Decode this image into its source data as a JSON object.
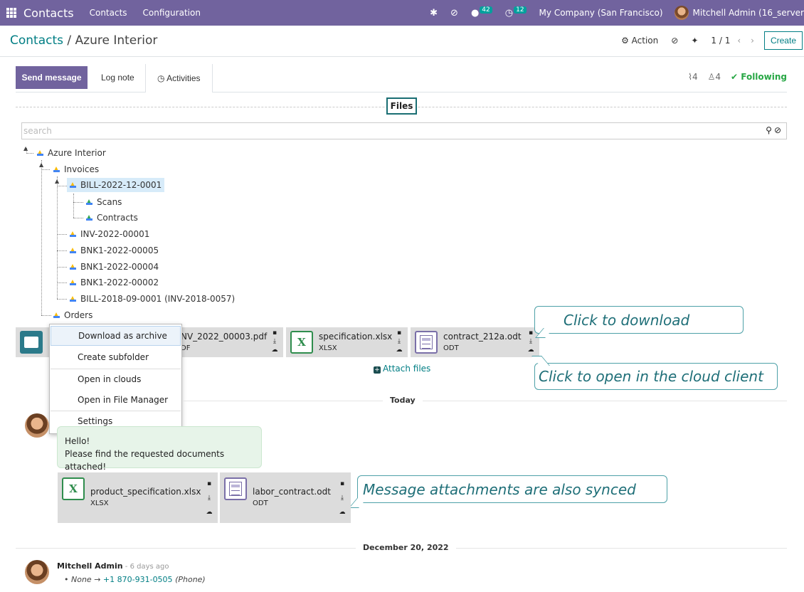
{
  "navbar": {
    "app_name": "Contacts",
    "menus": [
      "Contacts",
      "Configuration"
    ],
    "messages_count": "42",
    "activities_count": "12",
    "company": "My Company (San Francisco)",
    "user": "Mitchell Admin (16_server"
  },
  "control_panel": {
    "breadcrumb_root": "Contacts",
    "breadcrumb_sep": " / ",
    "breadcrumb_current": "Azure Interior",
    "action_label": "Action",
    "pager": "1 / 1",
    "create_label": "Create"
  },
  "chatter": {
    "send_message": "Send message",
    "log_note": "Log note",
    "activities": "Activities",
    "attachments_count": "4",
    "followers_count": "4",
    "following": "Following",
    "files_tab": "Files",
    "search_placeholder": "search",
    "attach_files": "Attach files"
  },
  "tree": {
    "root": "Azure Interior",
    "invoices": "Invoices",
    "bill_2022": "BILL-2022-12-0001",
    "scans": "Scans",
    "contracts": "Contracts",
    "inv_2022": "INV-2022-00001",
    "bnk_5": "BNK1-2022-00005",
    "bnk_4": "BNK1-2022-00004",
    "bnk_2": "BNK1-2022-00002",
    "bill_2018": "BILL-2018-09-0001 (INV-2018-0057)",
    "orders": "Orders"
  },
  "context_menu": {
    "items": [
      "Download as archive",
      "Create subfolder",
      "Open in clouds",
      "Open in File Manager",
      "Settings"
    ]
  },
  "files": [
    {
      "name": "INV_2022_00003.pdf",
      "visible_name": "NV_2022_00003.pdf",
      "ext": "PDF",
      "visible_ext": "DF",
      "icon": "image-file-icon"
    },
    {
      "name": "specification.xlsx",
      "ext": "XLSX",
      "icon": "spreadsheet-icon"
    },
    {
      "name": "contract_212a.odt",
      "ext": "ODT",
      "icon": "document-icon"
    }
  ],
  "callouts": {
    "download": "Click to download",
    "cloud": "Click to open in the cloud client",
    "synced": "Message attachments are also synced"
  },
  "messages": {
    "today_label": "Today",
    "body_line1": "Hello!",
    "body_line2": "Please find the requested documents attached!",
    "attachments": [
      {
        "name": "product_specification.xlsx",
        "ext": "XLSX"
      },
      {
        "name": "labor_contract.odt",
        "ext": "ODT"
      }
    ],
    "date_label": "December 20, 2022",
    "author": "Mitchell Admin",
    "ago": " - 6 days ago",
    "tracking_old": "None",
    "tracking_arrow": " → ",
    "tracking_new": "+1 870-931-0505",
    "tracking_field": "(Phone)"
  }
}
